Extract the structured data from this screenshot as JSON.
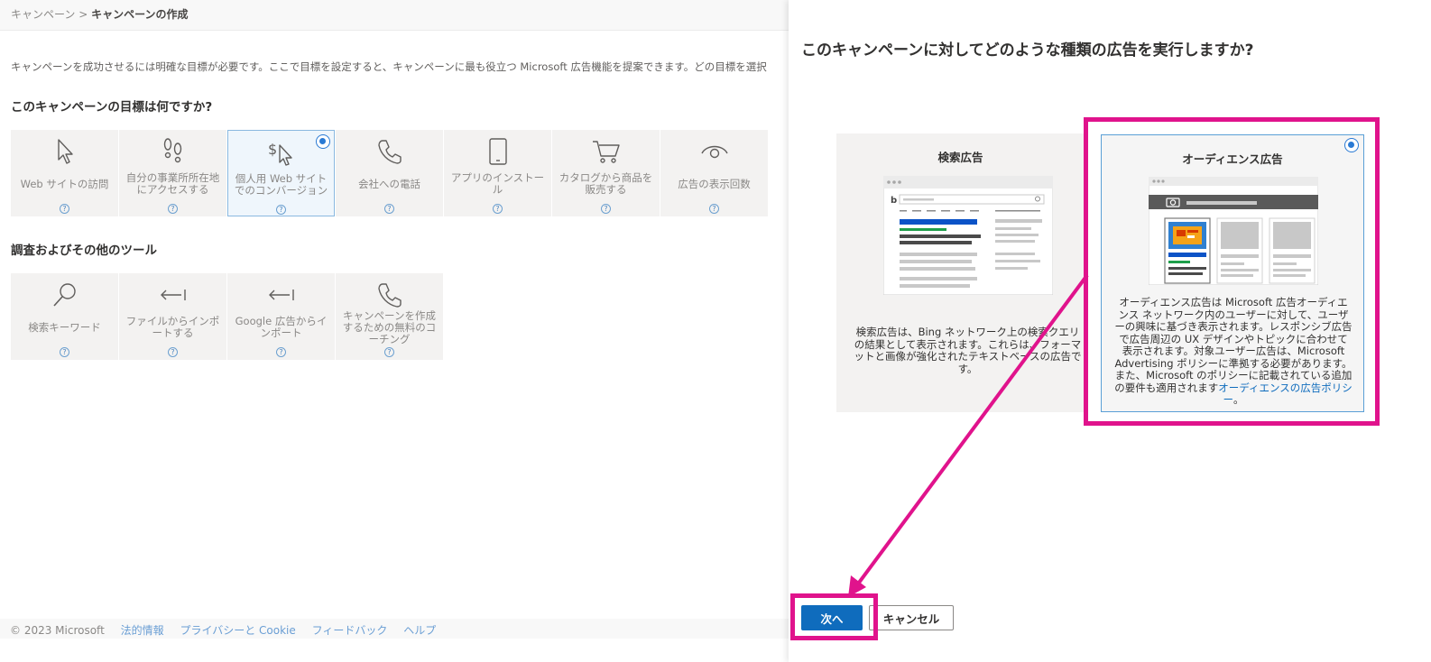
{
  "breadcrumb": {
    "root": "キャンペーン",
    "separator": ">",
    "current": "キャンペーンの作成"
  },
  "intro_text": "キャンペーンを成功させるには明確な目標が必要です。ここで目標を設定すると、キャンペーンに最も役立つ Microsoft 広告機能を提案できます。どの目標を選択",
  "goals": {
    "title": "このキャンペーンの目標は何ですか?",
    "items": [
      {
        "label": "Web サイトの訪問",
        "icon": "cursor-icon",
        "selected": false
      },
      {
        "label": "自分の事業所所在地にアクセスする",
        "icon": "footsteps-icon",
        "selected": false
      },
      {
        "label": "個人用 Web サイトでのコンバージョン",
        "icon": "dollar-cursor-icon",
        "selected": true
      },
      {
        "label": "会社への電話",
        "icon": "phone-icon",
        "selected": false
      },
      {
        "label": "アプリのインストール",
        "icon": "mobile-icon",
        "selected": false
      },
      {
        "label": "カタログから商品を販売する",
        "icon": "cart-icon",
        "selected": false
      },
      {
        "label": "広告の表示回数",
        "icon": "eye-icon",
        "selected": false
      }
    ]
  },
  "tools": {
    "title": "調査およびその他のツール",
    "items": [
      {
        "label": "検索キーワード",
        "icon": "search-icon"
      },
      {
        "label": "ファイルからインポートする",
        "icon": "import-arrow-icon"
      },
      {
        "label": "Google 広告からインポート",
        "icon": "import-arrow-icon"
      },
      {
        "label": "キャンペーンを作成するための無料のコーチング",
        "icon": "phone-icon"
      }
    ]
  },
  "help_glyph": "?",
  "footer": {
    "copyright": "© 2023 Microsoft",
    "links": [
      "法的情報",
      "プライバシーと Cookie",
      "フィードバック",
      "ヘルプ"
    ]
  },
  "panel": {
    "title": "このキャンペーンに対してどのような種類の広告を実行しますか?",
    "search_card": {
      "title": "検索広告",
      "description": "検索広告は、Bing ネットワーク上の検索クエリの結果として表示されます。これらは、フォーマットと画像が強化されたテキストベースの広告です。",
      "selected": false
    },
    "audience_card": {
      "title": "オーディエンス広告",
      "description": "オーディエンス広告は Microsoft 広告オーディエンス ネットワーク内のユーザーに対して、ユーザーの興味に基づき表示されます。レスポンシブ広告で広告周辺の UX デザインやトピックに合わせて表示されます。対象ユーザー広告は、Microsoft Advertising ポリシーに準拠する必要があります。また、Microsoft のポリシーに記載されている追加の要件も適用されます",
      "link_text": "オーディエンスの広告ポリシー",
      "trailing": "。",
      "selected": true
    },
    "next_button": "次へ",
    "cancel_button": "キャンセル"
  },
  "colors": {
    "primary": "#0f6cbd",
    "highlight": "#e0138c",
    "radio": "#2a7ad4"
  }
}
